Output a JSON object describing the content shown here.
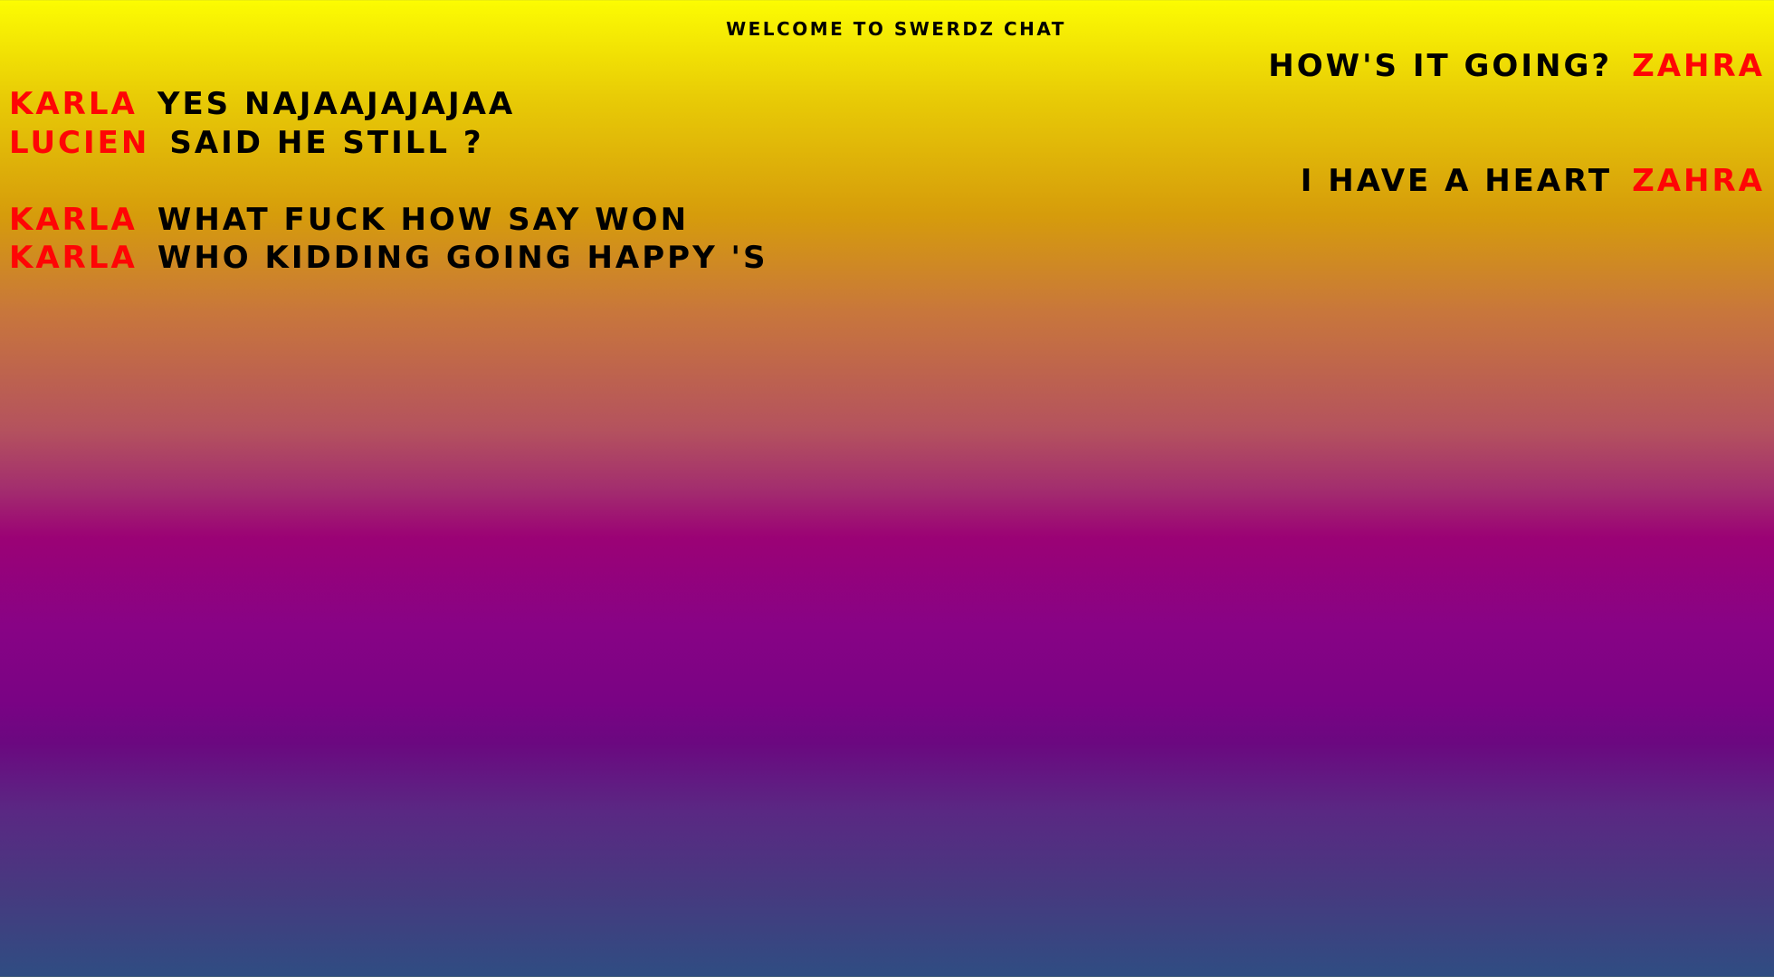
{
  "chat": {
    "title": "WELCOME TO SWERDZ CHAT",
    "name_color": "#ff0505",
    "messages": [
      {
        "sender": "ZAHRA",
        "text": "HOW'S IT GOING?",
        "side": "right"
      },
      {
        "sender": "KARLA",
        "text": "YES NAJAAJAJAJAA",
        "side": "left"
      },
      {
        "sender": "LUCIEN",
        "text": "SAID HE STILL ?",
        "side": "left"
      },
      {
        "sender": "ZAHRA",
        "text": "I HAVE A HEART",
        "side": "right"
      },
      {
        "sender": "KARLA",
        "text": "WHAT FUCK HOW SAY WON",
        "side": "left"
      },
      {
        "sender": "KARLA",
        "text": "WHO KIDDING GOING HAPPY 'S",
        "side": "left"
      }
    ]
  }
}
